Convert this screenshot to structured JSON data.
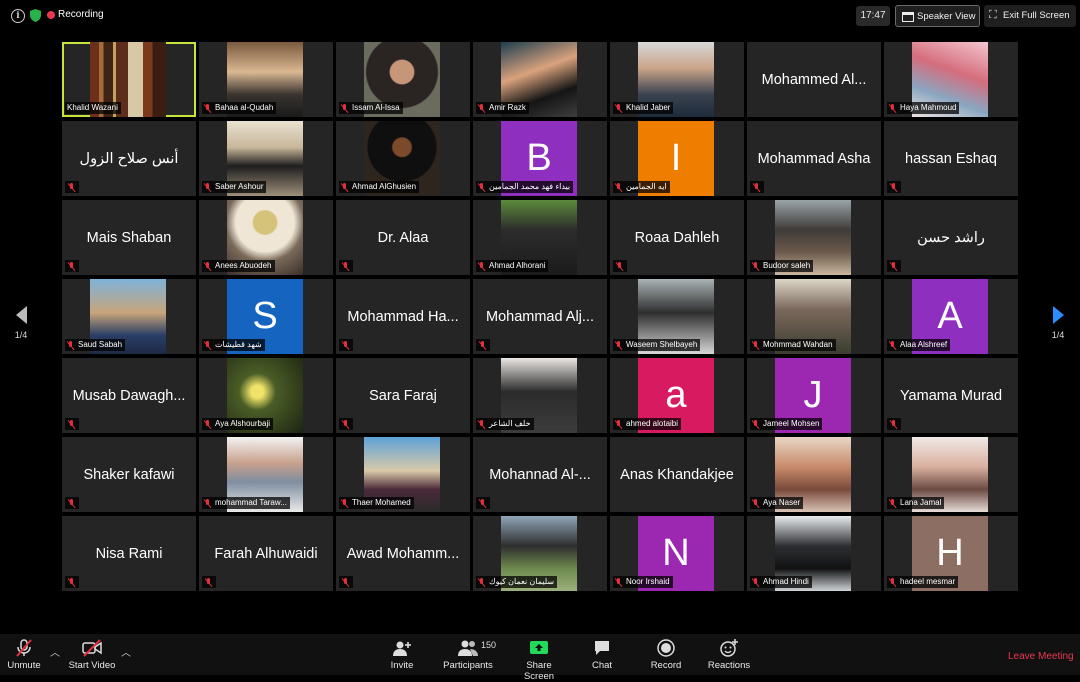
{
  "topbar": {
    "recording_label": "Recording",
    "clock": "17:47",
    "speaker_view_label": "Speaker View",
    "exit_fullscreen_label": "Exit Full Screen"
  },
  "pager": {
    "left": "1/4",
    "right": "1/4"
  },
  "accent_colors": {
    "active_speaker": "#c5e53a",
    "recording": "#e8384f",
    "muted": "#e0313e",
    "next_arrow": "#2d8cff"
  },
  "tiles": [
    {
      "name": "Khalid Wazani",
      "type": "photo",
      "img": "ph-books",
      "active": true,
      "muted": false
    },
    {
      "name": "Bahaa al-Qudah",
      "type": "photo",
      "img": "ph-1",
      "muted": true
    },
    {
      "name": "Issam Al-Issa",
      "type": "photo",
      "img": "ph-2",
      "muted": true
    },
    {
      "name": "Amir Razk",
      "type": "photo",
      "img": "ph-3",
      "muted": true
    },
    {
      "name": "Khalid Jaber",
      "type": "photo",
      "img": "ph-4",
      "muted": true
    },
    {
      "name": "Mohammed Al...",
      "type": "name",
      "muted": false
    },
    {
      "name": "Haya Mahmoud",
      "type": "photo",
      "img": "ph-5",
      "muted": true
    },
    {
      "name": "أنس صلاح الزول",
      "type": "name",
      "muted": true
    },
    {
      "name": "Saber Ashour",
      "type": "photo",
      "img": "ph-6",
      "muted": true
    },
    {
      "name": "Ahmad AlGhusien",
      "type": "photo",
      "img": "ph-7",
      "muted": true
    },
    {
      "name": "بيداء فهد محمد الجمامين",
      "type": "avatar",
      "letter": "B",
      "color": "#8e2fbf",
      "muted": true
    },
    {
      "name": "ايه الجمامين",
      "type": "avatar",
      "letter": "I",
      "color": "#ee7d00",
      "muted": true
    },
    {
      "name": "Mohammad Asha",
      "type": "name",
      "muted": true
    },
    {
      "name": "hassan Eshaq",
      "type": "name",
      "muted": true
    },
    {
      "name": "Mais Shaban",
      "type": "name",
      "muted": true
    },
    {
      "name": "Anees Abuodeh",
      "type": "photo",
      "img": "ph-9",
      "muted": true
    },
    {
      "name": "Dr. Alaa",
      "type": "name",
      "muted": true
    },
    {
      "name": "Ahmad Alhorani",
      "type": "photo",
      "img": "ph-8",
      "muted": true
    },
    {
      "name": "Roaa Dahleh",
      "type": "name",
      "muted": true
    },
    {
      "name": "Budoor saleh",
      "type": "photo",
      "img": "ph-10",
      "muted": true
    },
    {
      "name": "راشد حسن",
      "type": "name",
      "muted": true
    },
    {
      "name": "Saud Sabah",
      "type": "photo",
      "img": "ph-11",
      "muted": true
    },
    {
      "name": "شهد قطيشات",
      "type": "avatar",
      "letter": "S",
      "color": "#1565c0",
      "muted": true
    },
    {
      "name": "Mohammad Ha...",
      "type": "name",
      "muted": true
    },
    {
      "name": "Mohammad Alj...",
      "type": "name",
      "muted": true
    },
    {
      "name": "Waseem Shelbayeh",
      "type": "photo",
      "img": "ph-12",
      "muted": true
    },
    {
      "name": "Mohmmad Wahdan",
      "type": "photo",
      "img": "ph-13",
      "muted": true
    },
    {
      "name": "Alaa Alshreef",
      "type": "avatar",
      "letter": "A",
      "color": "#8e2fbf",
      "muted": true
    },
    {
      "name": "Musab Dawagh...",
      "type": "name",
      "muted": true
    },
    {
      "name": "Aya Alshourbaji",
      "type": "photo",
      "img": "ph-14",
      "muted": true
    },
    {
      "name": "Sara Faraj",
      "type": "name",
      "muted": true
    },
    {
      "name": "خلف الشاعر",
      "type": "photo",
      "img": "ph-15",
      "muted": true
    },
    {
      "name": "ahmed alotaibi",
      "type": "avatar",
      "letter": "a",
      "color": "#d81b60",
      "muted": true
    },
    {
      "name": "Jameel Mohsen",
      "type": "avatar",
      "letter": "J",
      "color": "#9c27b0",
      "muted": true
    },
    {
      "name": "Yamama Murad",
      "type": "name",
      "muted": true
    },
    {
      "name": "Shaker kafawi",
      "type": "name",
      "muted": true
    },
    {
      "name": "mohammad Taraw...",
      "type": "photo",
      "img": "ph-16",
      "muted": true
    },
    {
      "name": "Thaer Mohamed",
      "type": "photo",
      "img": "ph-17",
      "muted": true
    },
    {
      "name": "Mohannad Al-...",
      "type": "name",
      "muted": true
    },
    {
      "name": "Anas Khandakjee",
      "type": "name",
      "muted": false
    },
    {
      "name": "Aya Naser",
      "type": "photo",
      "img": "ph-18",
      "muted": true
    },
    {
      "name": "Lana Jamal",
      "type": "photo",
      "img": "ph-19",
      "muted": true
    },
    {
      "name": "Nisa Rami",
      "type": "name",
      "muted": true
    },
    {
      "name": "Farah Alhuwaidi",
      "type": "name",
      "muted": true
    },
    {
      "name": "Awad Mohamm...",
      "type": "name",
      "muted": true
    },
    {
      "name": "سليمان نعمان كيوك",
      "type": "photo",
      "img": "ph-20",
      "muted": true
    },
    {
      "name": "Noor Irshaid",
      "type": "avatar",
      "letter": "N",
      "color": "#9c27b0",
      "muted": true
    },
    {
      "name": "Ahmad Hindi",
      "type": "photo",
      "img": "ph-21",
      "muted": true
    },
    {
      "name": "hadeel mesmar",
      "type": "avatar",
      "letter": "H",
      "color": "#8d6e63",
      "muted": true
    }
  ],
  "toolbar": {
    "unmute": "Unmute",
    "start_video": "Start Video",
    "invite": "Invite",
    "participants": "Participants",
    "participants_count": "150",
    "share_screen": "Share Screen",
    "chat": "Chat",
    "record": "Record",
    "reactions": "Reactions",
    "leave": "Leave Meeting"
  }
}
